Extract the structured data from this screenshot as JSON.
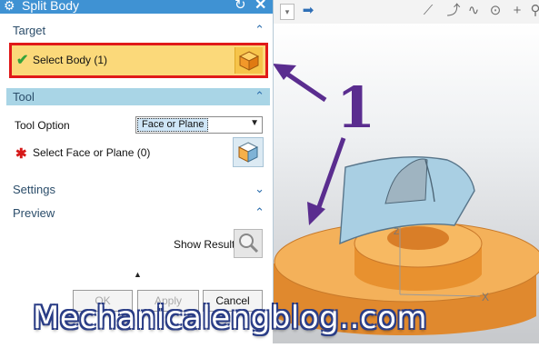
{
  "dialog": {
    "title": "Split Body",
    "sections": {
      "target": {
        "title": "Target",
        "select_body_label": "Select Body (1)"
      },
      "tool": {
        "title": "Tool",
        "option_label": "Tool Option",
        "option_value": "Face or Plane",
        "select_face_label": "Select Face or Plane (0)"
      },
      "settings": {
        "title": "Settings"
      },
      "preview": {
        "title": "Preview",
        "show_result_label": "Show Result"
      }
    },
    "buttons": {
      "ok": "OK",
      "apply": "Apply",
      "cancel": "Cancel"
    }
  },
  "annotation": {
    "number": "1",
    "color": "#5a2d8f",
    "highlight_color": "#e01a1a"
  },
  "watermark": "Mechanicalengblog..com",
  "colors": {
    "titlebar": "#3f92d3",
    "selected_row": "#fbd97a",
    "tool_header": "#a9d5e6",
    "part_body": "#f2a640",
    "sheet_body": "#a9cfe3"
  },
  "icons": [
    "gear-icon",
    "reset-icon",
    "close-icon",
    "checkmark-icon",
    "cube-icon",
    "asterisk-icon",
    "chevron-up-icon",
    "chevron-down-icon",
    "magnifier-icon",
    "expand-triangle-icon"
  ]
}
